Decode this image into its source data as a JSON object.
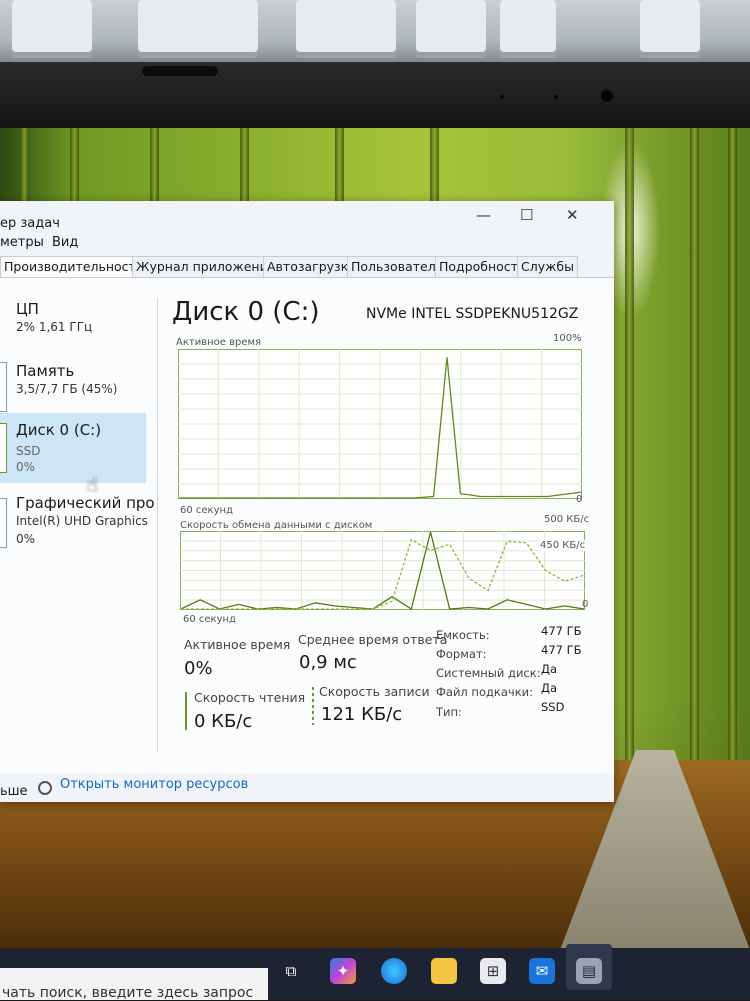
{
  "window": {
    "title": "ер задач",
    "menu": [
      "метры",
      "Вид"
    ],
    "tabs": [
      "Производительность",
      "Журнал приложений",
      "Автозагрузка",
      "Пользователи",
      "Подробности",
      "Службы"
    ]
  },
  "sidebar": {
    "items": [
      {
        "name": "ЦП",
        "sub": "2% 1,61 ГГц"
      },
      {
        "name": "Память",
        "sub": "3,5/7,7 ГБ (45%)"
      },
      {
        "name": "Диск 0 (C:)",
        "sub": "SSD",
        "sub2": "0%"
      },
      {
        "name": "Графический про",
        "sub": "Intel(R) UHD Graphics",
        "sub2": "0%"
      }
    ]
  },
  "disk": {
    "title": "Диск 0 (C:)",
    "model": "NVMe INTEL SSDPEKNU512GZ",
    "graph1": {
      "label": "Активное время",
      "max": "100%",
      "min": "0",
      "time": "60 секунд"
    },
    "graph2": {
      "label": "Скорость обмена данными с диском",
      "max": "500 КБ/с",
      "mid": "450 КБ/с",
      "min": "0",
      "time": "60 секунд"
    },
    "stats": {
      "active_label": "Активное время",
      "active_value": "0%",
      "response_label": "Среднее время ответа",
      "response_value": "0,9 мс",
      "read_label": "Скорость чтения",
      "read_value": "0 КБ/с",
      "write_label": "Скорость записи",
      "write_value": "121 КБ/с"
    },
    "props": [
      {
        "label": "Емкость:",
        "value": "477 ГБ"
      },
      {
        "label": "Формат:",
        "value": "477 ГБ"
      },
      {
        "label": "Системный диск:",
        "value": "Да"
      },
      {
        "label": "Файл подкачки:",
        "value": "Да"
      },
      {
        "label": "Тип:",
        "value": "SSD"
      }
    ]
  },
  "footer": {
    "less": "ьше",
    "monitor_link": "Открыть монитор ресурсов"
  },
  "taskbar": {
    "search_text": "чать поиск, введите здесь запрос"
  },
  "chart_data": [
    {
      "type": "line",
      "title": "Активное время",
      "ylim": [
        0,
        100
      ],
      "xlabel": "60 секунд",
      "x": [
        0,
        10,
        20,
        30,
        35,
        38,
        40,
        42,
        45,
        50,
        55,
        60
      ],
      "values": [
        0,
        0,
        0,
        0,
        0,
        1,
        95,
        3,
        1,
        1,
        1,
        4
      ]
    },
    {
      "type": "line",
      "title": "Скорость обмена данными с диском",
      "ylim": [
        0,
        500
      ],
      "xlabel": "60 секунд",
      "series": [
        {
          "values": [
            0,
            60,
            0,
            30,
            0,
            10,
            0,
            40,
            20,
            10,
            0,
            80,
            0,
            500,
            0,
            10,
            0,
            60,
            30,
            0,
            20,
            0
          ]
        },
        {
          "values": [
            0,
            0,
            0,
            0,
            0,
            0,
            0,
            0,
            0,
            0,
            0,
            50,
            450,
            380,
            420,
            200,
            120,
            440,
            430,
            250,
            180,
            220
          ]
        }
      ]
    }
  ]
}
